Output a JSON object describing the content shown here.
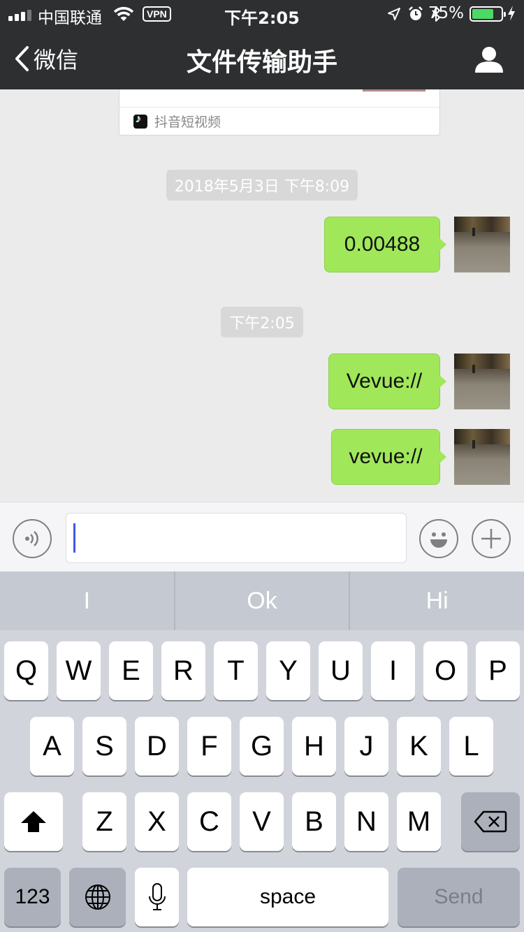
{
  "status": {
    "carrier": "中国联通",
    "vpn": "VPN",
    "time": "下午2:05",
    "battery_pct": "75%",
    "battery_level": 0.75,
    "battery_color": "#4cd964"
  },
  "nav": {
    "back_label": "微信",
    "title": "文件传输助手"
  },
  "chat": {
    "card_source": "抖音短视频",
    "stamp1": "2018年5月3日 下午8:09",
    "msg1": "0.00488",
    "stamp2": "下午2:05",
    "msg2": "Vevue://",
    "msg3": "vevue://",
    "bubble_color": "#a0e75a"
  },
  "input": {
    "value": ""
  },
  "keyboard": {
    "suggestions": [
      "I",
      "Ok",
      "Hi"
    ],
    "row1": [
      "Q",
      "W",
      "E",
      "R",
      "T",
      "Y",
      "U",
      "I",
      "O",
      "P"
    ],
    "row2": [
      "A",
      "S",
      "D",
      "F",
      "G",
      "H",
      "J",
      "K",
      "L"
    ],
    "row3": [
      "Z",
      "X",
      "C",
      "V",
      "B",
      "N",
      "M"
    ],
    "numbers": "123",
    "space": "space",
    "send": "Send"
  }
}
